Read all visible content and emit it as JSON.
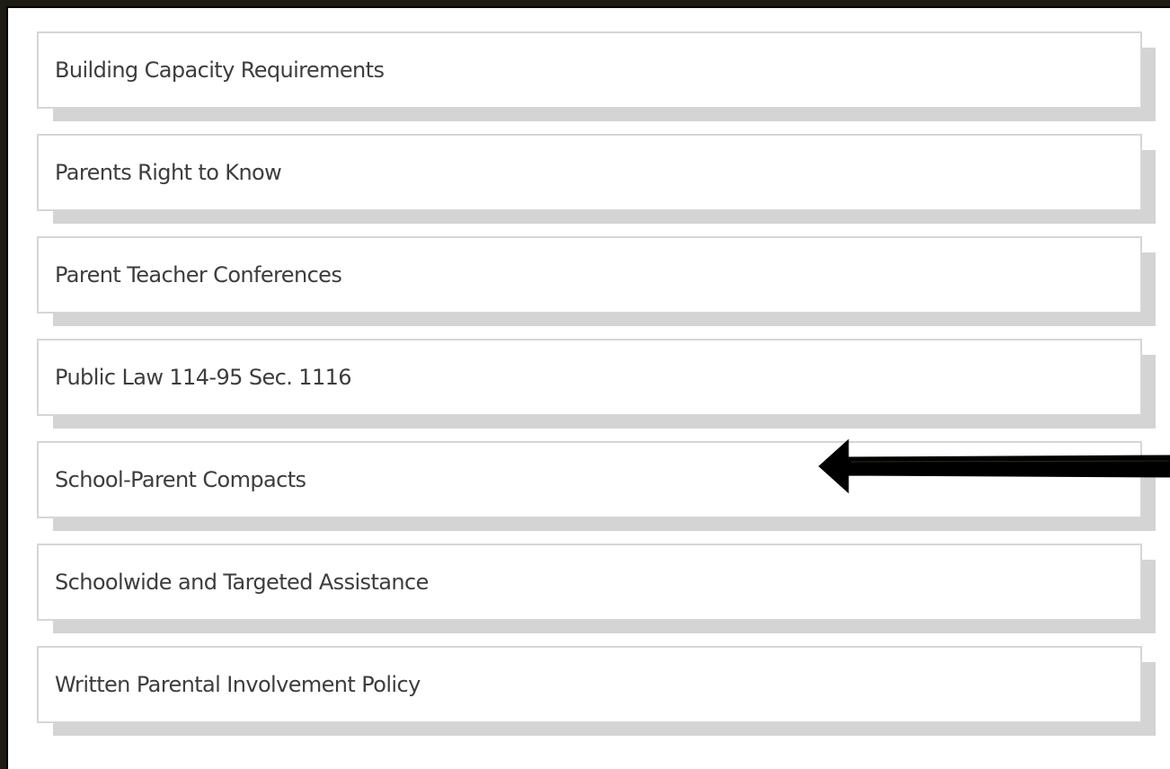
{
  "links": [
    {
      "label": "Building Capacity Requirements"
    },
    {
      "label": "Parents Right to Know"
    },
    {
      "label": "Parent Teacher Conferences"
    },
    {
      "label": "Public Law 114-95 Sec. 1116"
    },
    {
      "label": "School-Parent Compacts"
    },
    {
      "label": "Schoolwide and Targeted Assistance"
    },
    {
      "label": "Written Parental Involvement Policy"
    }
  ],
  "annotation": {
    "icon": "left-arrow-icon",
    "points_to": "School-Parent Compacts",
    "color": "#000000"
  },
  "colors": {
    "page_background": "#ffffff",
    "card_border": "#d6d6d6",
    "card_shadow": "#d4d4d4",
    "text": "#3d3d3d",
    "outer_frame": "#1e1b14"
  }
}
